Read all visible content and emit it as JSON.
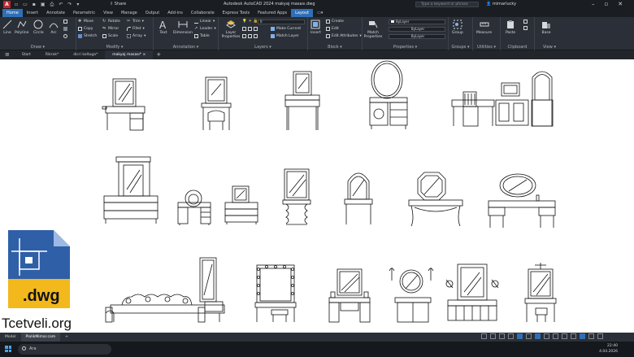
{
  "titlebar": {
    "logo": "A",
    "share": "Share",
    "title": "Autodesk AutoCAD 2024    makyaj masası.dwg",
    "search_placeholder": "Type a keyword or phrase",
    "user": "mimarlucky"
  },
  "ribbon_tabs": [
    "Home",
    "Insert",
    "Annotate",
    "Parametric",
    "View",
    "Manage",
    "Output",
    "Add-ins",
    "Collaborate",
    "Express Tools",
    "Featured Apps",
    "Layout"
  ],
  "ribbon": {
    "draw": {
      "label": "Draw",
      "line": "Line",
      "polyline": "Polyline",
      "circle": "Circle",
      "arc": "Arc"
    },
    "modify": {
      "label": "Modify",
      "move": "Move",
      "rotate": "Rotate",
      "trim": "Trim",
      "copy": "Copy",
      "mirror": "Mirror",
      "fillet": "Fillet",
      "stretch": "Stretch",
      "scale": "Scale",
      "array": "Array"
    },
    "annotation": {
      "label": "Annotation",
      "text": "Text",
      "dimension": "Dimension",
      "linear": "Linear",
      "leader": "Leader",
      "table": "Table"
    },
    "layers": {
      "label": "Layers",
      "layer_properties": "Layer Properties",
      "make_current": "Make Current",
      "match_layer": "Match Layer",
      "layer_value": "0"
    },
    "block": {
      "label": "Block",
      "insert": "Insert",
      "create": "Create",
      "edit": "Edit",
      "edit_attributes": "Edit Attributes"
    },
    "properties": {
      "label": "Properties",
      "match_properties": "Match Properties",
      "color": "ByLayer",
      "linetype": "ByLayer",
      "lineweight": "ByLayer"
    },
    "groups": {
      "label": "Groups",
      "group": "Group"
    },
    "utilities": {
      "label": "Utilities",
      "measure": "Measure"
    },
    "clipboard": {
      "label": "Clipboard",
      "paste": "Paste"
    },
    "view": {
      "label": "View",
      "base": "Base"
    }
  },
  "file_tabs": [
    "Start",
    "Rikrok*",
    "dicri koltuga*",
    "makyaj masası*"
  ],
  "layout_tabs": [
    "Model",
    "PlolikMimar.com"
  ],
  "watermark": {
    "ext": ".dwg",
    "site": "Tcetveli.org"
  },
  "taskbar": {
    "search": "Ara",
    "time": "22:40",
    "date": "4.04.2026"
  }
}
